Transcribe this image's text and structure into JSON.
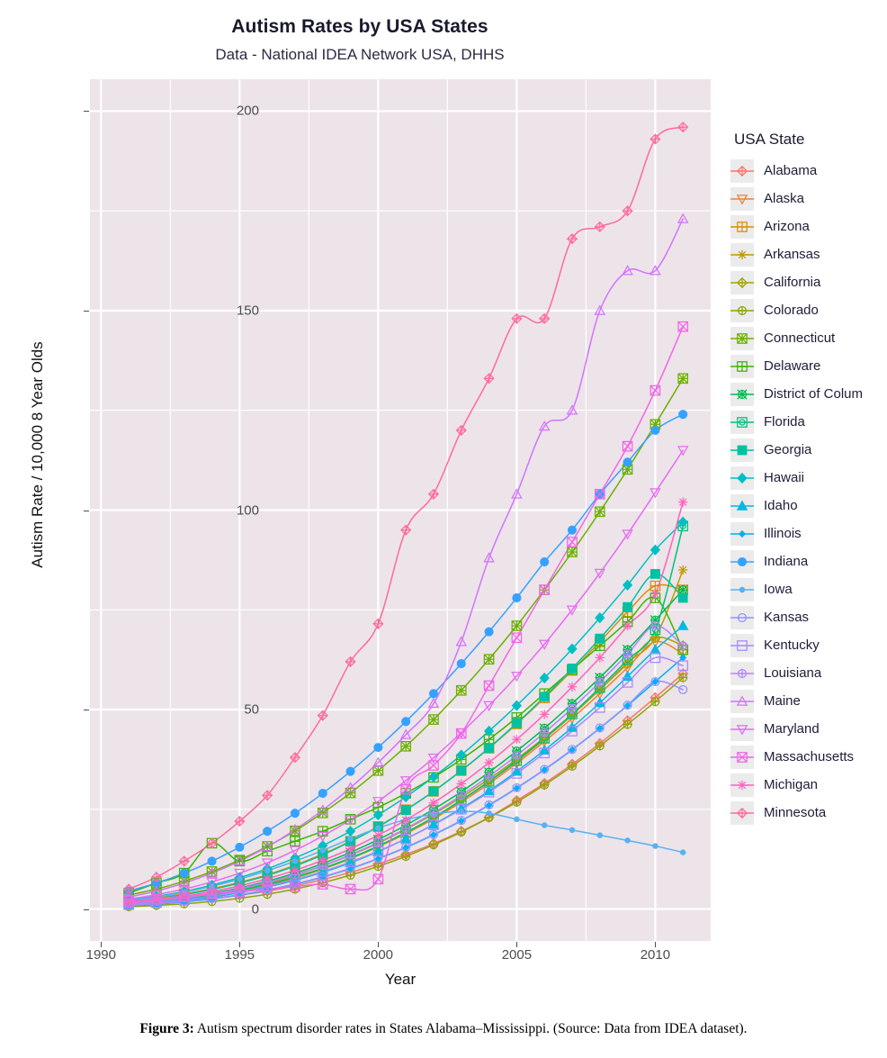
{
  "figure": {
    "caption_prefix": "Figure 3:",
    "caption_text": " Autism spectrum disorder rates in States Alabama–Mississippi.  (Source: Data from IDEA dataset)."
  },
  "legend": {
    "title": "USA State"
  },
  "chart_data": {
    "type": "line",
    "title": "Autism Rates by USA States",
    "subtitle": "Data - National IDEA Network USA, DHHS",
    "xlabel": "Year",
    "ylabel": "Autism Rate / 10,000  8 Year Olds",
    "xlim": [
      1989.6,
      2012.0
    ],
    "ylim": [
      -8,
      208
    ],
    "xticks": [
      1990,
      1995,
      2000,
      2005,
      2010
    ],
    "yticks": [
      0,
      50,
      100,
      150,
      200
    ],
    "xtick_labels": [
      "1990",
      "1995",
      "2000",
      "2005",
      "2010"
    ],
    "ytick_labels": [
      "0",
      "50",
      "100",
      "150",
      "200"
    ],
    "grid": true,
    "grid_minor": true,
    "panel_background": "#ece4e9",
    "grid_color": "#ffffff",
    "legend_position": "right",
    "legend_title": "USA State",
    "x": [
      1991,
      1992,
      1993,
      1994,
      1995,
      1996,
      1997,
      1998,
      1999,
      2000,
      2001,
      2002,
      2003,
      2004,
      2005,
      2006,
      2007,
      2008,
      2009,
      2010,
      2011
    ],
    "series": [
      {
        "name": "Alabama",
        "color": "#F8766D",
        "shape": "diamond-plus",
        "values": [
          1.0,
          1.4,
          2.0,
          2.7,
          3.5,
          4.5,
          5.8,
          7.4,
          9.2,
          11.3,
          13.7,
          16.4,
          19.5,
          23.0,
          27.2,
          31.5,
          36.3,
          41.5,
          47.2,
          53.0,
          59.0
        ]
      },
      {
        "name": "Alaska",
        "color": "#EB8335",
        "shape": "triangle-down",
        "values": [
          1.2,
          1.8,
          2.6,
          3.6,
          4.8,
          6.3,
          8.1,
          10.2,
          12.7,
          15.6,
          18.9,
          22.6,
          26.8,
          31.4,
          36.5,
          42.0,
          47.8,
          54.0,
          60.5,
          67.0,
          64.0
        ]
      },
      {
        "name": "Arizona",
        "color": "#D89000",
        "shape": "square-plus",
        "values": [
          2.0,
          2.8,
          3.8,
          5.1,
          6.7,
          8.6,
          11.0,
          13.8,
          17.0,
          20.7,
          24.9,
          29.5,
          34.7,
          40.3,
          46.4,
          52.9,
          59.8,
          67.0,
          74.5,
          81.0,
          80.0
        ]
      },
      {
        "name": "Arkansas",
        "color": "#C09B00",
        "shape": "asterisk",
        "values": [
          1.0,
          1.5,
          2.2,
          3.2,
          4.4,
          5.9,
          7.8,
          10.0,
          12.6,
          15.6,
          19.0,
          22.9,
          27.2,
          31.9,
          37.0,
          42.6,
          48.6,
          55.0,
          61.8,
          68.0,
          85.0
        ]
      },
      {
        "name": "California",
        "color": "#A3A500",
        "shape": "diamond-plus",
        "values": [
          1.3,
          1.9,
          2.7,
          3.7,
          5.0,
          6.6,
          8.5,
          10.8,
          13.5,
          16.5,
          20.0,
          23.8,
          28.0,
          32.6,
          37.6,
          43.0,
          48.8,
          55.0,
          61.5,
          68.0,
          66.0
        ]
      },
      {
        "name": "Colorado",
        "color": "#8AA700",
        "shape": "circle-plus",
        "values": [
          0.6,
          0.9,
          1.3,
          1.9,
          2.7,
          3.7,
          5.0,
          6.6,
          8.5,
          10.7,
          13.2,
          16.1,
          19.3,
          22.9,
          26.8,
          31.1,
          35.8,
          40.9,
          46.3,
          52.0,
          58.0
        ]
      },
      {
        "name": "Connecticut",
        "color": "#6BB100",
        "shape": "star-square",
        "values": [
          3.5,
          5.0,
          7.0,
          9.4,
          12.3,
          15.7,
          19.6,
          24.1,
          29.1,
          34.7,
          40.8,
          47.5,
          54.8,
          62.6,
          71.0,
          80.0,
          89.5,
          99.6,
          110.2,
          121.5,
          133.0
        ]
      },
      {
        "name": "Delaware",
        "color": "#39B600",
        "shape": "square-grid",
        "values": [
          4.0,
          6.5,
          9.0,
          16.5,
          12.0,
          14.5,
          17.0,
          19.5,
          22.5,
          25.5,
          29.0,
          33.0,
          37.5,
          42.5,
          48.0,
          54.0,
          60.0,
          66.0,
          72.0,
          78.0,
          65.0
        ]
      },
      {
        "name": "District of Colum",
        "color": "#00BB4E",
        "shape": "star-circle",
        "values": [
          1.5,
          2.1,
          2.9,
          4.0,
          5.3,
          7.0,
          9.0,
          11.4,
          14.2,
          17.4,
          21.0,
          25.0,
          29.4,
          34.3,
          39.6,
          45.3,
          51.5,
          58.0,
          65.0,
          72.4,
          80.0
        ]
      },
      {
        "name": "Florida",
        "color": "#00BF7D",
        "shape": "square-circle",
        "values": [
          1.2,
          1.8,
          2.5,
          3.5,
          4.7,
          6.2,
          8.0,
          10.2,
          12.8,
          15.8,
          19.2,
          23.0,
          27.3,
          32.0,
          37.2,
          42.8,
          48.9,
          55.5,
          62.5,
          70.0,
          96.0
        ]
      },
      {
        "name": "Georgia",
        "color": "#00C1A3",
        "shape": "square-filled",
        "values": [
          1.8,
          2.6,
          3.6,
          4.9,
          6.5,
          8.4,
          10.8,
          13.6,
          16.9,
          20.6,
          24.8,
          29.5,
          34.7,
          40.4,
          46.6,
          53.2,
          60.3,
          67.8,
          75.7,
          84.0,
          78.0
        ]
      },
      {
        "name": "Hawaii",
        "color": "#00BFC4",
        "shape": "diamond-filled",
        "values": [
          2.2,
          3.2,
          4.4,
          6.0,
          7.9,
          10.1,
          12.8,
          15.9,
          19.5,
          23.6,
          28.1,
          33.1,
          38.6,
          44.6,
          51.0,
          57.9,
          65.2,
          73.0,
          81.2,
          90.0,
          97.0
        ]
      },
      {
        "name": "Idaho",
        "color": "#00BAE0",
        "shape": "triangle-filled",
        "values": [
          1.0,
          1.5,
          2.1,
          3.0,
          4.1,
          5.5,
          7.2,
          9.2,
          11.6,
          14.4,
          17.6,
          21.2,
          25.2,
          29.6,
          34.5,
          39.8,
          45.5,
          51.7,
          58.3,
          65.0,
          71.0
        ]
      },
      {
        "name": "Illinois",
        "color": "#00B0F6",
        "shape": "diamond-small",
        "values": [
          0.8,
          1.2,
          1.8,
          2.5,
          3.5,
          4.7,
          6.2,
          8.0,
          10.1,
          12.6,
          15.4,
          18.6,
          22.1,
          26.0,
          30.3,
          34.9,
          39.9,
          45.3,
          51.0,
          57.0,
          63.0
        ]
      },
      {
        "name": "Indiana",
        "color": "#35A2FF",
        "shape": "circle-filled",
        "values": [
          4.5,
          6.5,
          9.0,
          12.0,
          15.5,
          19.5,
          24.0,
          29.0,
          34.5,
          40.5,
          47.0,
          54.0,
          61.5,
          69.5,
          78.0,
          87.0,
          95.0,
          104.0,
          112.0,
          120.0,
          124.0
        ]
      },
      {
        "name": "Iowa",
        "color": "#56B1F7",
        "shape": "dot",
        "values": [
          2.0,
          3.0,
          4.2,
          5.7,
          7.5,
          9.6,
          12.0,
          14.7,
          17.6,
          20.3,
          22.4,
          23.8,
          24.5,
          24.0,
          22.5,
          21.0,
          19.8,
          18.5,
          17.2,
          15.8,
          14.2
        ]
      },
      {
        "name": "Kansas",
        "color": "#9590FF",
        "shape": "circle-open",
        "values": [
          0.9,
          1.3,
          1.9,
          2.6,
          3.6,
          4.8,
          6.3,
          8.1,
          10.2,
          12.7,
          15.5,
          18.7,
          22.2,
          26.1,
          30.4,
          35.0,
          40.0,
          45.4,
          51.1,
          57.0,
          55.0
        ]
      },
      {
        "name": "Kentucky",
        "color": "#A58AFF",
        "shape": "square-open",
        "values": [
          1.1,
          1.6,
          2.3,
          3.2,
          4.3,
          5.7,
          7.4,
          9.4,
          11.8,
          14.5,
          17.6,
          21.1,
          25.0,
          29.3,
          34.0,
          39.1,
          44.6,
          50.5,
          56.8,
          63.0,
          61.0
        ]
      },
      {
        "name": "Louisiana",
        "color": "#B983FF",
        "shape": "circle-plus",
        "values": [
          1.4,
          2.0,
          2.8,
          3.8,
          5.1,
          6.7,
          8.6,
          10.9,
          13.6,
          16.7,
          20.2,
          24.1,
          28.5,
          33.3,
          38.5,
          44.2,
          50.3,
          56.9,
          63.9,
          71.0,
          66.0
        ]
      },
      {
        "name": "Maine",
        "color": "#D373FC",
        "shape": "triangle-open",
        "values": [
          3.0,
          4.5,
          6.5,
          9.0,
          12.0,
          15.6,
          19.9,
          24.8,
          30.4,
          36.7,
          43.7,
          51.5,
          67.0,
          88.0,
          104.0,
          121.0,
          125.0,
          150.0,
          160.0,
          160.0,
          173.0
        ]
      },
      {
        "name": "Maryland",
        "color": "#E76BF3",
        "shape": "triangle-down-open",
        "values": [
          2.5,
          3.6,
          5.0,
          6.8,
          9.0,
          11.6,
          14.7,
          18.3,
          22.4,
          27.0,
          32.2,
          37.9,
          44.2,
          51.0,
          58.4,
          66.4,
          75.0,
          84.2,
          94.0,
          104.4,
          115.0
        ]
      },
      {
        "name": "Massachusetts",
        "color": "#F265E8",
        "shape": "square-x",
        "values": [
          2.0,
          2.6,
          3.2,
          3.8,
          4.4,
          5.0,
          5.6,
          6.2,
          5.0,
          7.5,
          30.0,
          36.0,
          44.0,
          56.0,
          68.0,
          80.0,
          92.0,
          104.0,
          116.0,
          130.0,
          146.0
        ]
      },
      {
        "name": "Michigan",
        "color": "#FF62BC",
        "shape": "asterisk",
        "values": [
          1.6,
          2.3,
          3.2,
          4.4,
          5.8,
          7.6,
          9.7,
          12.2,
          15.1,
          18.5,
          22.3,
          26.6,
          31.4,
          36.7,
          42.5,
          48.8,
          55.7,
          63.0,
          71.0,
          79.0,
          102.0
        ]
      },
      {
        "name": "Minnesota",
        "color": "#FF6A98",
        "shape": "diamond-plus",
        "values": [
          5.0,
          8.0,
          12.0,
          16.5,
          22.0,
          28.5,
          38.0,
          48.5,
          62.0,
          71.5,
          95.0,
          104.0,
          120.0,
          133.0,
          148.0,
          148.0,
          168.0,
          171.0,
          175.0,
          193.0,
          196.0
        ]
      }
    ]
  }
}
